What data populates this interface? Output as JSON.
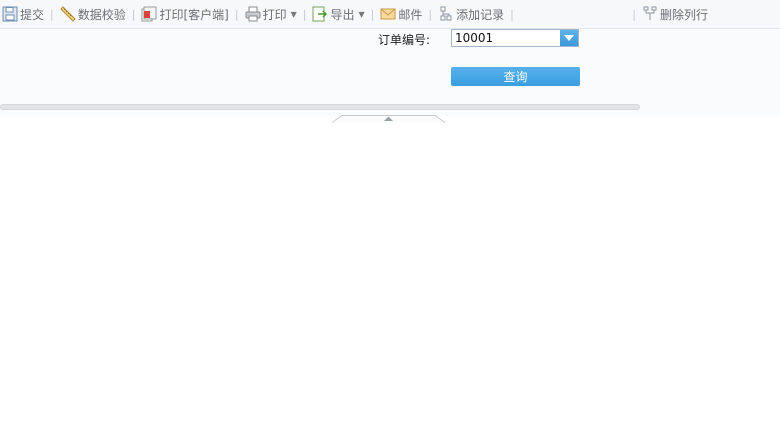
{
  "toolbar": {
    "items": [
      {
        "label": "提交",
        "icon": "save-icon"
      },
      {
        "label": "数据校验",
        "icon": "ruler-icon"
      },
      {
        "label": "打印[客户端]",
        "icon": "print-client-icon"
      },
      {
        "label": "打印",
        "icon": "printer-icon"
      },
      {
        "label": "导出",
        "icon": "export-icon"
      },
      {
        "label": "邮件",
        "icon": "mail-icon"
      },
      {
        "label": "添加记录",
        "icon": "add-record-icon"
      },
      {
        "label": "删除列行",
        "icon": "delete-row-icon"
      }
    ]
  },
  "form": {
    "order_label": "订单编号:",
    "order_value": "10001",
    "query_label": "查询"
  },
  "colors": {
    "accent": "#3c9de0",
    "toolbar_bg": "#f7f8fa"
  }
}
